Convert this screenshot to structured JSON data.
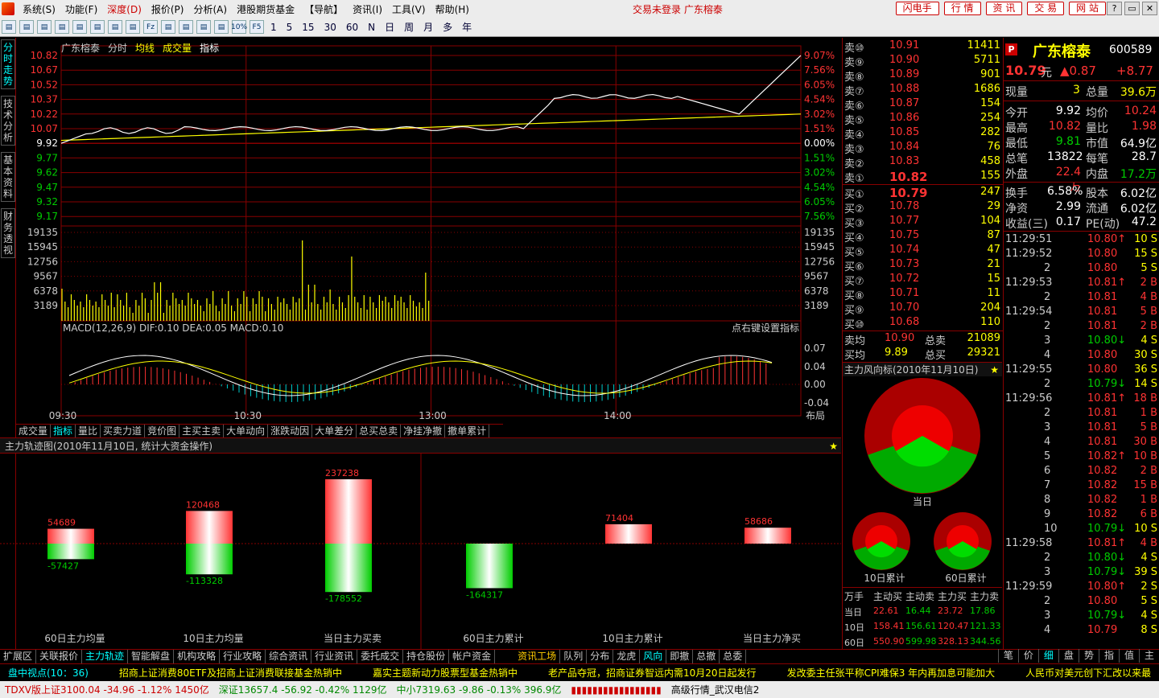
{
  "menu": {
    "items": [
      "系统(S)",
      "功能(F)",
      "深度(D)",
      "报价(P)",
      "分析(A)",
      "港股期货基金",
      "【导航】",
      "资讯(I)",
      "工具(V)",
      "帮助(H)"
    ],
    "title": "交易未登录 广东榕泰",
    "right_buttons": [
      "闪电手",
      "行 情",
      "资 讯",
      "交 易",
      "网 站"
    ]
  },
  "toolbar": {
    "icons": [
      "10%",
      "Fz",
      "F5"
    ],
    "periods": [
      "1",
      "5",
      "15",
      "30",
      "60",
      "N",
      "日",
      "周",
      "月",
      "多",
      "年"
    ]
  },
  "lefttabs": [
    "分时走势",
    "技术分析",
    "基本资料",
    "财务透视"
  ],
  "chart": {
    "name": "广东榕泰",
    "tabs": [
      "分时",
      "均线",
      "成交量",
      "指标"
    ],
    "price_labels": [
      "10.82",
      "10.67",
      "10.52",
      "10.37",
      "10.22",
      "10.07",
      "9.92",
      "9.77",
      "9.62",
      "9.47",
      "9.32",
      "9.17"
    ],
    "pct_labels": [
      "9.07%",
      "7.56%",
      "6.05%",
      "4.54%",
      "3.02%",
      "1.51%",
      "0.00%",
      "1.51%",
      "3.02%",
      "4.54%",
      "6.05%",
      "7.56%"
    ],
    "vol_labels": [
      "19135",
      "15945",
      "12756",
      "9567",
      "6378",
      "3189"
    ],
    "macd_title": "MACD(12,26,9) DIF:0.10 DEA:0.05 MACD:0.10",
    "macd_hint": "点右键设置指标",
    "macd_labels": [
      "0.07",
      "0.04",
      "0.00",
      "-0.04"
    ],
    "time_labels": [
      "09:30",
      "10:30",
      "13:00",
      "14:00"
    ],
    "layout_label": "布局"
  },
  "subtabs": [
    "成交量",
    "指标",
    "量比",
    "买卖力道",
    "竞价图",
    "主买主卖",
    "大单动向",
    "涨跌动因",
    "大单差分",
    "总买总卖",
    "净挂净撤",
    "撤单累计"
  ],
  "flow": {
    "title": "主力轨迹图(2010年11月10日, 统计大资金操作)",
    "groups": [
      {
        "label": "60日主力均量",
        "up": 54689,
        "down": -57427
      },
      {
        "label": "10日主力均量",
        "up": 120468,
        "down": -113328
      },
      {
        "label": "当日主力买卖",
        "up": 237238,
        "down": -178552
      },
      {
        "label": "60日主力累计",
        "up": 0,
        "down": -164317
      },
      {
        "label": "10日主力累计",
        "up": 71404,
        "down": 0
      },
      {
        "label": "当日主力净买",
        "up": 58686,
        "down": 0
      }
    ]
  },
  "quotes": {
    "sells": [
      {
        "l": "卖⑩",
        "p": "10.91",
        "v": "11411"
      },
      {
        "l": "卖⑨",
        "p": "10.90",
        "v": "5711"
      },
      {
        "l": "卖⑧",
        "p": "10.89",
        "v": "901"
      },
      {
        "l": "卖⑦",
        "p": "10.88",
        "v": "1686"
      },
      {
        "l": "卖⑥",
        "p": "10.87",
        "v": "154"
      },
      {
        "l": "卖⑤",
        "p": "10.86",
        "v": "254"
      },
      {
        "l": "卖④",
        "p": "10.85",
        "v": "282"
      },
      {
        "l": "卖③",
        "p": "10.84",
        "v": "76"
      },
      {
        "l": "卖②",
        "p": "10.83",
        "v": "458"
      },
      {
        "l": "卖①",
        "p": "10.82",
        "v": "155"
      }
    ],
    "buys": [
      {
        "l": "买①",
        "p": "10.79",
        "v": "247"
      },
      {
        "l": "买②",
        "p": "10.78",
        "v": "29"
      },
      {
        "l": "买③",
        "p": "10.77",
        "v": "104"
      },
      {
        "l": "买④",
        "p": "10.75",
        "v": "87"
      },
      {
        "l": "买⑤",
        "p": "10.74",
        "v": "47"
      },
      {
        "l": "买⑥",
        "p": "10.73",
        "v": "21"
      },
      {
        "l": "买⑦",
        "p": "10.72",
        "v": "15"
      },
      {
        "l": "买⑧",
        "p": "10.71",
        "v": "11"
      },
      {
        "l": "买⑨",
        "p": "10.70",
        "v": "204"
      },
      {
        "l": "买⑩",
        "p": "10.68",
        "v": "110"
      }
    ],
    "avg": [
      {
        "l": "卖均",
        "p": "10.90",
        "l2": "总卖",
        "v": "21089"
      },
      {
        "l": "买均",
        "p": "9.89",
        "l2": "总买",
        "v": "29321"
      }
    ]
  },
  "fx": {
    "title": "主力风向标(2010年11月10日)",
    "today": "当日",
    "d10": "10日累计",
    "d60": "60日累计",
    "headers": [
      "万手",
      "主动买",
      "主动卖",
      "主力买",
      "主力卖"
    ],
    "rows": [
      [
        "当日",
        "22.61",
        "16.44",
        "23.72",
        "17.86"
      ],
      [
        "10日",
        "158.41",
        "156.61",
        "120.47",
        "121.33"
      ],
      [
        "60日",
        "550.90",
        "599.98",
        "328.13",
        "344.56"
      ]
    ]
  },
  "stock": {
    "flag": "P",
    "name": "广东榕泰",
    "code": "600589",
    "price": "10.79",
    "unit": "元",
    "chg": "▲0.87",
    "pct": "+8.77",
    "xianliang": "3",
    "zongliang": "39.6万",
    "kv": [
      [
        "今开",
        "9.92",
        "均价",
        "10.24"
      ],
      [
        "最高",
        "10.82",
        "量比",
        "1.98"
      ],
      [
        "最低",
        "9.81",
        "市值",
        "64.9亿"
      ],
      [
        "总笔",
        "13822",
        "每笔",
        "28.7"
      ],
      [
        "外盘",
        "22.4万",
        "内盘",
        "17.2万"
      ],
      [
        "换手",
        "6.58%",
        "股本",
        "6.02亿"
      ],
      [
        "净资",
        "2.99",
        "流通",
        "6.02亿"
      ],
      [
        "收益(三)",
        "0.17",
        "PE(动)",
        "47.2"
      ]
    ]
  },
  "ticks": [
    [
      "11:29:51",
      "10.80↑",
      "10 S"
    ],
    [
      "11:29:52",
      "10.80",
      "15 S"
    ],
    [
      "2",
      "10.80",
      "5 S"
    ],
    [
      "11:29:53",
      "10.81↑",
      "2 B"
    ],
    [
      "2",
      "10.81",
      "4 B"
    ],
    [
      "11:29:54",
      "10.81",
      "5 B"
    ],
    [
      "2",
      "10.81",
      "2 B"
    ],
    [
      "3",
      "10.80↓",
      "4 S"
    ],
    [
      "4",
      "10.80",
      "30 S"
    ],
    [
      "11:29:55",
      "10.80",
      "36 S"
    ],
    [
      "2",
      "10.79↓",
      "14 S"
    ],
    [
      "11:29:56",
      "10.81↑",
      "18 B"
    ],
    [
      "2",
      "10.81",
      "1 B"
    ],
    [
      "3",
      "10.81",
      "5 B"
    ],
    [
      "4",
      "10.81",
      "30 B"
    ],
    [
      "5",
      "10.82↑",
      "10 B"
    ],
    [
      "6",
      "10.82",
      "2 B"
    ],
    [
      "7",
      "10.82",
      "15 B"
    ],
    [
      "8",
      "10.82",
      "1 B"
    ],
    [
      "9",
      "10.82",
      "6 B"
    ],
    [
      "10",
      "10.79↓",
      "10 S"
    ],
    [
      "11:29:58",
      "10.81↑",
      "4 B"
    ],
    [
      "2",
      "10.80↓",
      "4 S"
    ],
    [
      "3",
      "10.79↓",
      "39 S"
    ],
    [
      "11:29:59",
      "10.80↑",
      "2 S"
    ],
    [
      "2",
      "10.80",
      "5 S"
    ],
    [
      "3",
      "10.79↓",
      "4 S"
    ],
    [
      "4",
      "10.79",
      "8 S"
    ]
  ],
  "bottomtabs": [
    "扩展区",
    "关联报价",
    "主力轨迹",
    "智能解盘",
    "机构攻略",
    "行业攻略",
    "综合资讯",
    "行业资讯",
    "委托成交",
    "持仓股份",
    "帐户资金",
    "资讯工场",
    "队列",
    "分布",
    "龙虎",
    "风向",
    "即撤",
    "总撤",
    "总委"
  ],
  "right_tabs": [
    "笔",
    "价",
    "细",
    "盘",
    "势",
    "指",
    "值",
    "主"
  ],
  "ticker": [
    "盘中视点(10：36)",
    "招商上证消费80ETF及招商上证消费联接基金热销中",
    "嘉实主题新动力股票型基金热销中",
    "老产品夺冠，招商证券智远内需10月20日起发行",
    "发改委主任张平称CPI难保3 年内再加息可能加大",
    "人民币对美元创下汇改以来最"
  ],
  "status": {
    "sh": "TDXV版上证3100.04 -34.96 -1.12% 1450亿",
    "sz": "深证13657.4 -56.92 -0.42% 1129亿",
    "zx": "中小7319.63 -9.86 -0.13% 396.9亿",
    "net": "高级行情_武汉电信2"
  }
}
